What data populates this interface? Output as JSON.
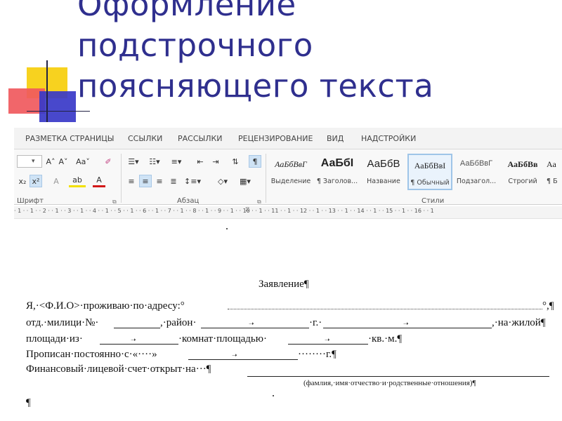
{
  "slide": {
    "title_lines": [
      "Оформление",
      "подстрочного",
      "поясняющего текста"
    ]
  },
  "ribbon": {
    "tabs": [
      "РАЗМЕТКА СТРАНИЦЫ",
      "ССЫЛКИ",
      "РАССЫЛКИ",
      "РЕЦЕНЗИРОВАНИЕ",
      "ВИД",
      "НАДСТРОЙКИ"
    ],
    "groups": {
      "font": "Шрифт",
      "paragraph": "Абзац",
      "styles": "Стили"
    },
    "font_buttons": {
      "grow": "A˄",
      "shrink": "A˅",
      "case": "Aa˅",
      "clear": "✐",
      "subscript": "x₂",
      "superscript": "x²",
      "effects": "A",
      "highlight": "ab",
      "color": "A"
    },
    "styles": [
      {
        "sample": "АаБбВвГ",
        "name": "Выделение"
      },
      {
        "sample": "АаБбI",
        "name": "¶ Заголов..."
      },
      {
        "sample": "АаБбВ",
        "name": "Название"
      },
      {
        "sample": "АаБбВвI",
        "name": "¶ Обычный"
      },
      {
        "sample": "АаБбВвГ",
        "name": "Подзагол..."
      },
      {
        "sample": "АаБбВв",
        "name": "Строгий"
      },
      {
        "sample": "Аа",
        "name": "¶ Б"
      }
    ],
    "ruler_text": "· 1 · · 1 · · 2 · · 1 · · 3 · · 1 · · 4 · · 1 · · 5 · · 1 · · 6 · · 1 · · 7 · · 1 · · 8 · · 1 · · 9 · · 1 · · 10 · · 1 · · 11 · · 1 · · 12 · · 1 · · 13 · · 1 · · 14 · · 1 · · 15 · · 1 · · 16 · · 1"
  },
  "document": {
    "heading": "Заявление¶",
    "line1_start": "Я,·<Ф.И.О>·проживаю·по·адресу:°",
    "line1_end": "°,¶",
    "line2_a": "отд.·милици·№·",
    "line2_b": ",·район·",
    "line2_c": "·г.·",
    "line2_d": ",·на·жилой¶",
    "line3_a": "площади·из·",
    "line3_b": "·комнат·площадью·",
    "line3_c": "·кв.·м.¶",
    "line4_a": "Прописан·постоянно·с·«····»",
    "line4_b": "········г.¶",
    "line5": "Финансовый·лицевой·счет·открыт·на···¶",
    "caption": "(фамлия,·имя·отчество·и·родственные·отношения)¶",
    "end_mark": "¶"
  }
}
